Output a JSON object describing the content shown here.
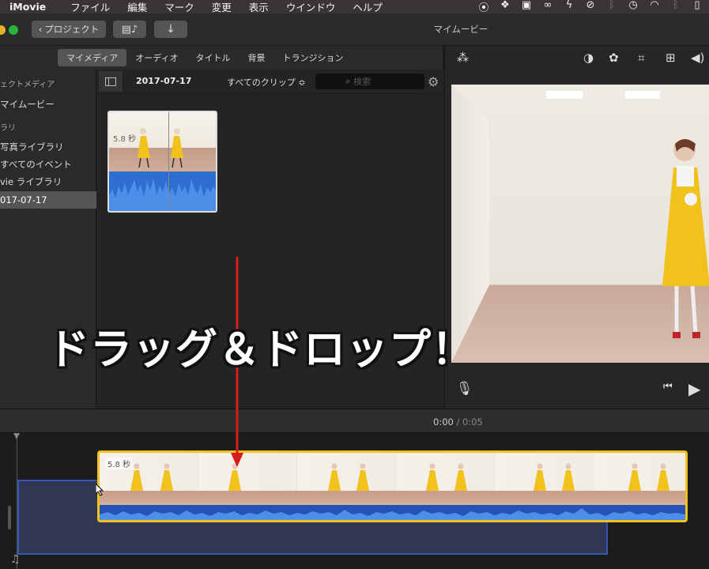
{
  "menubar": {
    "app_name": "iMovie",
    "items": [
      "ファイル",
      "編集",
      "マーク",
      "変更",
      "表示",
      "ウインドウ",
      "ヘルプ"
    ],
    "status_icons": [
      "record-icon",
      "dropbox-icon",
      "box-icon",
      "glasses-icon",
      "bolt-icon",
      "no-sign-icon",
      "bluetooth-faint-icon",
      "clock-icon",
      "wifi-icon",
      "bluetooth-icon",
      "battery-icon"
    ]
  },
  "toolbar": {
    "projects_label": "プロジェクト",
    "window_title": "マイムービー"
  },
  "library_tabs": [
    "マイメディア",
    "オーディオ",
    "タイトル",
    "背景",
    "トランジション"
  ],
  "sidebar": {
    "section_project": "ェクトメディア",
    "project_name": "マイムービー",
    "section_library": "ラリ",
    "items": [
      "写真ライブラリ",
      "すべてのイベント",
      "vie ライブラリ",
      "017-07-17"
    ]
  },
  "browser": {
    "date": "2017-07-17",
    "filter": "すべてのクリップ ≎",
    "search_placeholder": "検索",
    "clip_duration": "5.8 秒"
  },
  "timeline": {
    "current_time": "0:00",
    "separator": "/",
    "total_time": "0:05",
    "clip_duration": "5.8 秒"
  },
  "annotation": {
    "caption": "ドラッグ＆ドロップ！",
    "arrow_color": "#d81b1b"
  },
  "colors": {
    "clip_border": "#f2c21c",
    "audio_wave": "#2f6dd0",
    "drop_zone_border": "#3458b8"
  }
}
